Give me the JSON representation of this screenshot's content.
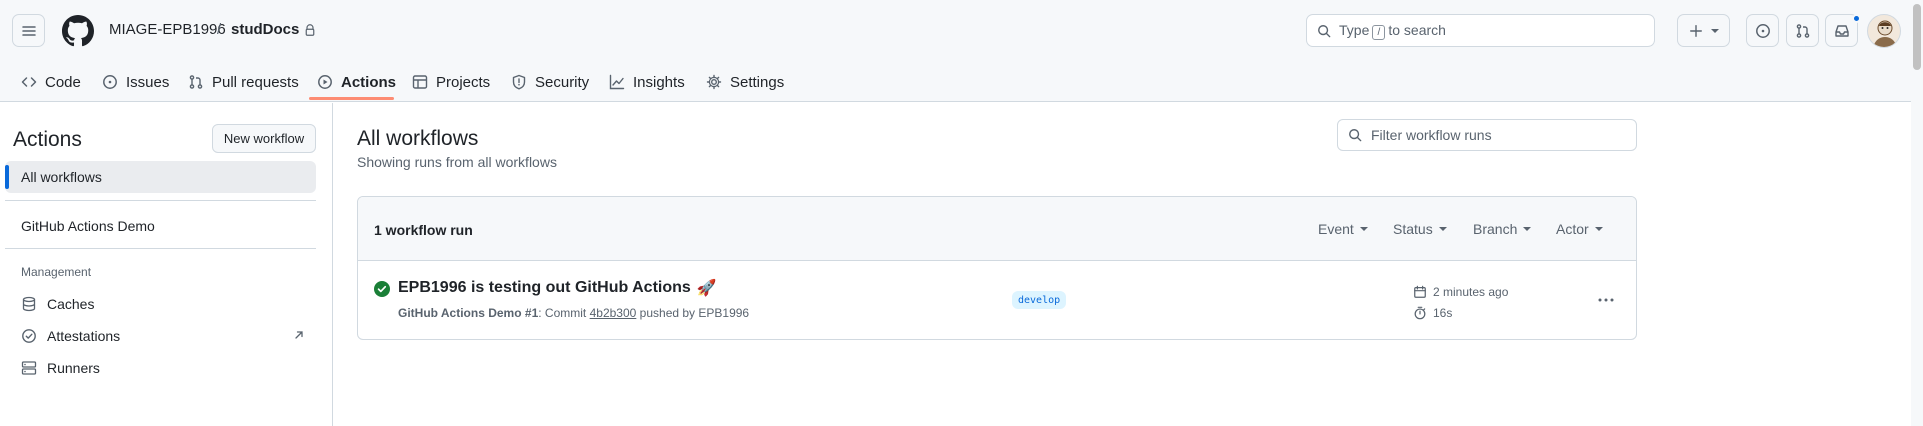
{
  "header": {
    "owner": "MIAGE-EPB1996",
    "separator": "/",
    "repo": "studDocs",
    "search_prefix": "Type",
    "search_key": "/",
    "search_suffix": "to search"
  },
  "tabs": [
    {
      "label": "Code",
      "icon": "code-icon"
    },
    {
      "label": "Issues",
      "icon": "issue-opened-icon"
    },
    {
      "label": "Pull requests",
      "icon": "git-pull-request-icon"
    },
    {
      "label": "Actions",
      "icon": "play-icon",
      "active": true
    },
    {
      "label": "Projects",
      "icon": "table-icon"
    },
    {
      "label": "Security",
      "icon": "shield-icon"
    },
    {
      "label": "Insights",
      "icon": "graph-icon"
    },
    {
      "label": "Settings",
      "icon": "gear-icon"
    }
  ],
  "sidebar": {
    "title": "Actions",
    "new_workflow_label": "New workflow",
    "all_workflows": "All workflows",
    "workflows": [
      "GitHub Actions Demo"
    ],
    "management_heading": "Management",
    "management_items": [
      {
        "label": "Caches",
        "icon": "database-icon"
      },
      {
        "label": "Attestations",
        "icon": "verified-icon"
      },
      {
        "label": "Runners",
        "icon": "server-icon"
      }
    ]
  },
  "main": {
    "title": "All workflows",
    "subtitle": "Showing runs from all workflows",
    "filter_placeholder": "Filter workflow runs",
    "runs_count": "1 workflow run",
    "filters": [
      "Event",
      "Status",
      "Branch",
      "Actor"
    ],
    "runs": [
      {
        "title": "EPB1996 is testing out GitHub Actions",
        "emoji": "🚀",
        "workflow": "GitHub Actions Demo",
        "run_number": "#1",
        "meta_commit": ": Commit",
        "sha": "4b2b300",
        "pushed_by": "pushed by EPB1996",
        "branch": "develop",
        "time_ago": "2 minutes ago",
        "duration": "16s",
        "status": "success"
      }
    ]
  },
  "colors": {
    "accent": "#0969da",
    "success": "#1a7f37",
    "tab_underline": "#fd8c73"
  }
}
